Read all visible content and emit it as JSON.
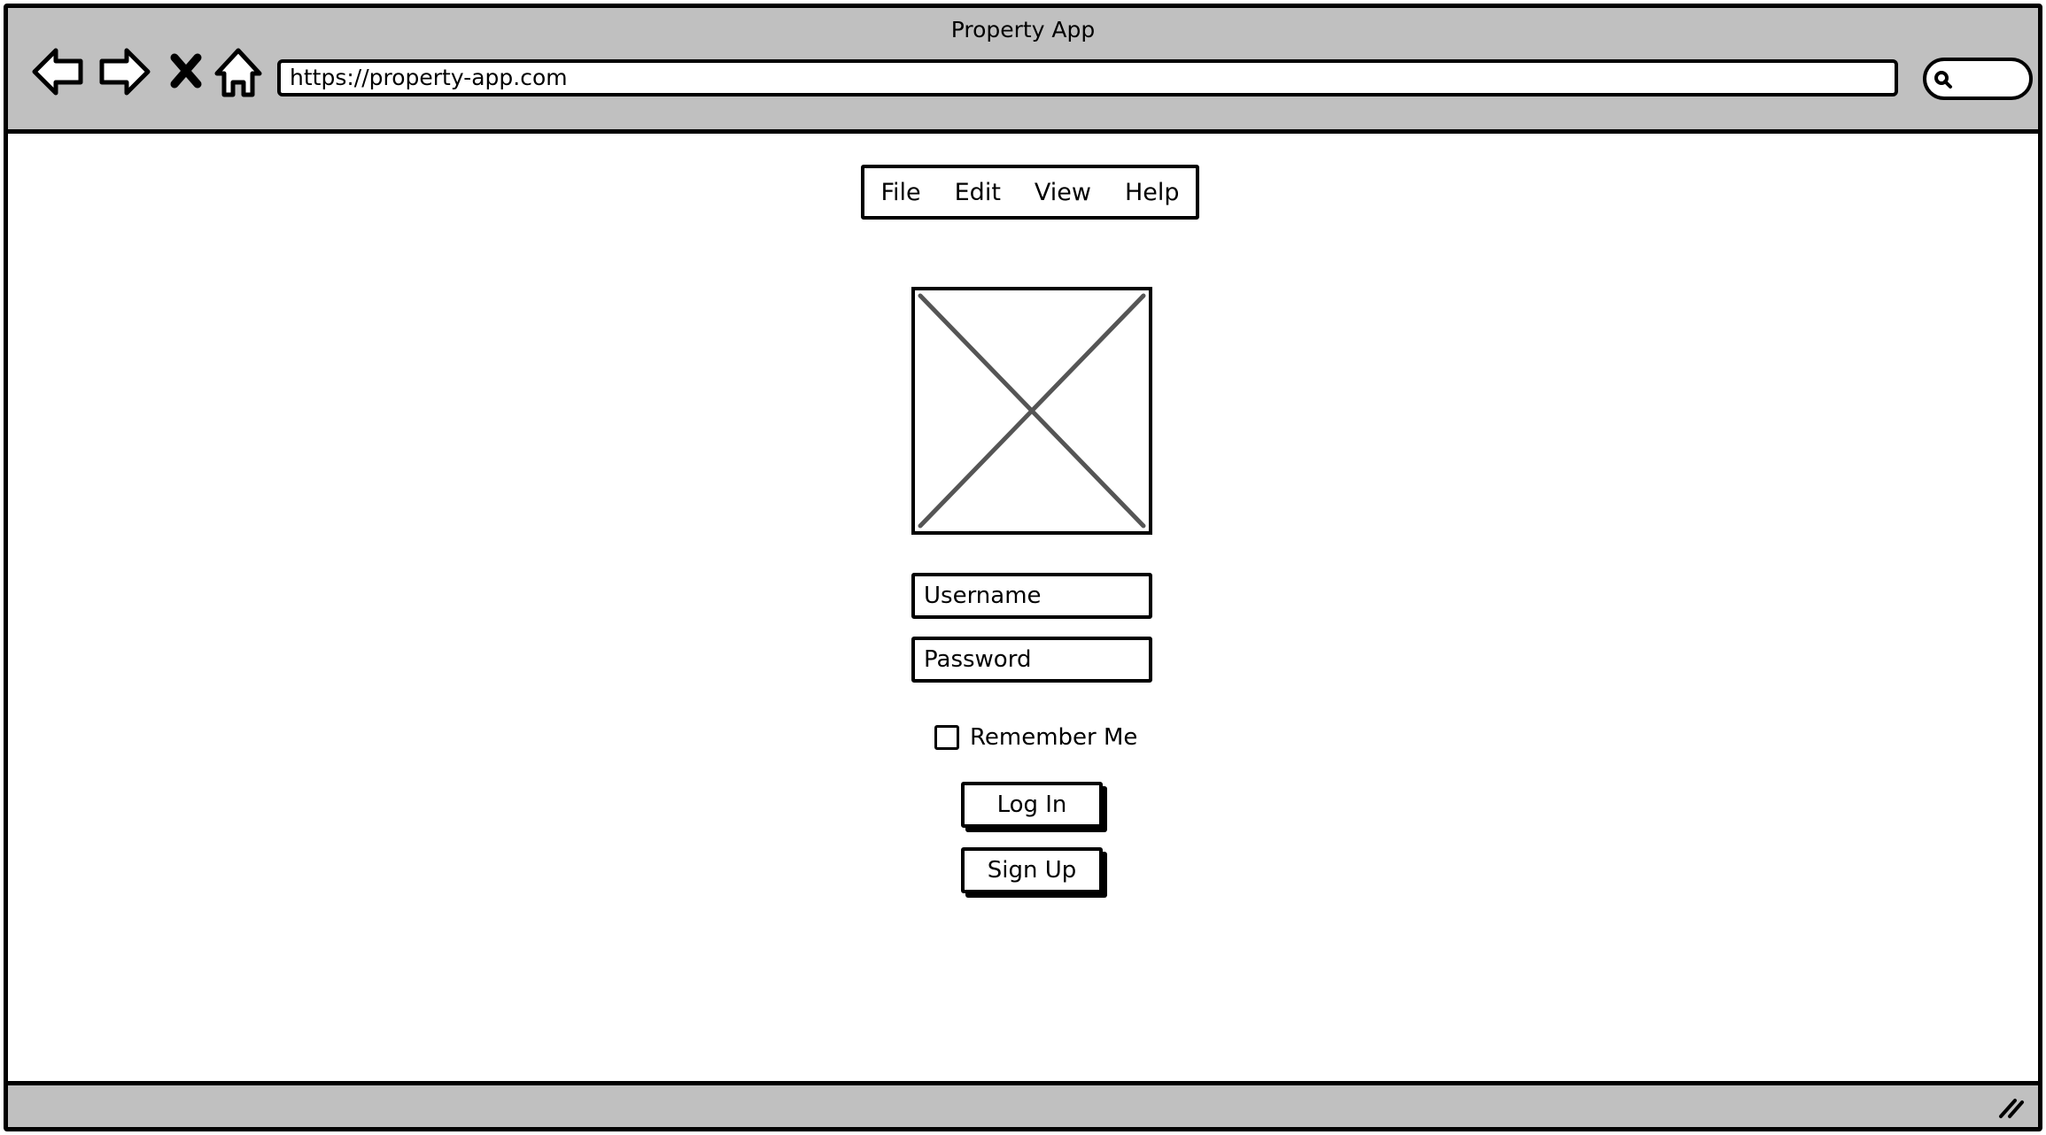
{
  "window": {
    "title": "Property App"
  },
  "toolbar": {
    "icons": [
      "back-arrow-icon",
      "forward-arrow-icon",
      "stop-icon",
      "home-icon",
      "search-icon"
    ],
    "url": "https://property-app.com"
  },
  "menu": {
    "items": [
      {
        "label": "File"
      },
      {
        "label": "Edit"
      },
      {
        "label": "View"
      },
      {
        "label": "Help"
      }
    ]
  },
  "login": {
    "username_placeholder": "Username",
    "password_placeholder": "Password",
    "remember_label": "Remember Me",
    "remember_checked": false,
    "login_label": "Log In",
    "signup_label": "Sign Up"
  },
  "colors": {
    "chrome": "#c0c0c0",
    "outline": "#000000",
    "placeholder_cross": "#555555",
    "background": "#ffffff"
  }
}
